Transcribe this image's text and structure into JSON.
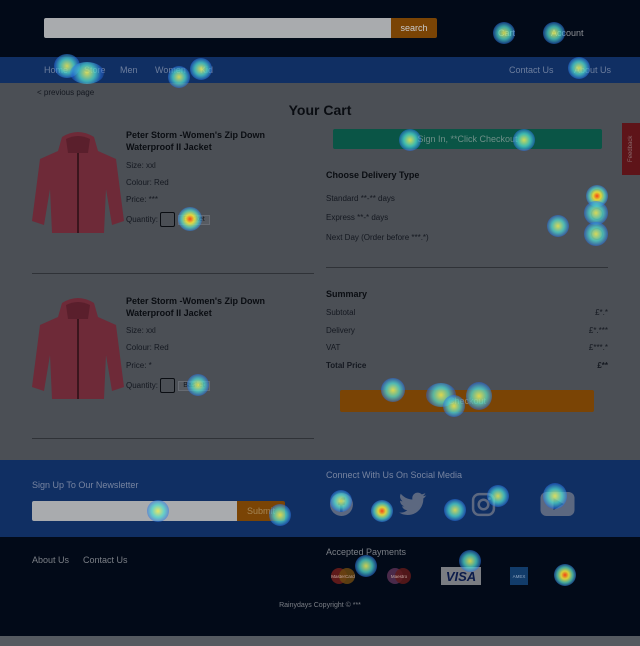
{
  "header": {
    "search_placeholder": "",
    "search_button": "search",
    "cart_link": "Cart",
    "account_link": "Account"
  },
  "nav": {
    "left": [
      "Home",
      "Store",
      "Men",
      "Women",
      "Kid"
    ],
    "right": [
      "Contact Us",
      "About Us"
    ]
  },
  "page": {
    "previous_page": "< previous page",
    "title": "Your Cart",
    "feedback_tab": "Feedback"
  },
  "products": [
    {
      "name": "Peter Storm -Women's Zip Down Waterproof II Jacket",
      "size": "Size: xxl",
      "colour": "Colour: Red",
      "price": "Price: ***",
      "quantity_label": "Quantity:",
      "basket_button": "Basket"
    },
    {
      "name": "Peter Storm -Women's Zip Down Waterproof II Jacket",
      "size": "Size: xxl",
      "colour": "Colour: Red",
      "price": "Price: *",
      "quantity_label": "Quantity:",
      "basket_button": "Basket"
    }
  ],
  "checkout": {
    "signin_button": "Sign In, **Click Checkout",
    "delivery_heading": "Choose Delivery Type",
    "delivery_options": [
      "Standard **-** days",
      "Express **-* days",
      "Next Day (Order before ***.*)"
    ],
    "summary_heading": "Summary",
    "summary_rows": [
      {
        "label": "Subtotal",
        "value": "£*.*"
      },
      {
        "label": "Delivery",
        "value": "£*.***"
      },
      {
        "label": "VAT",
        "value": "£***.*"
      },
      {
        "label": "Total Price",
        "value": "£**"
      }
    ],
    "checkout_button": "Checkout"
  },
  "newsletter": {
    "heading": "Sign Up To Our Newsletter",
    "input_placeholder": "",
    "submit_button": "Submit",
    "social_heading": "Connect With Us On Social Media"
  },
  "footer": {
    "links": [
      "About Us",
      "Contact Us"
    ],
    "payments_heading": "Accepted Payments",
    "payment_labels": [
      "MasterCard",
      "Maestro",
      "VISA",
      "AMEX"
    ],
    "copyright": "Rainydays Copyright © ***"
  },
  "colors": {
    "top_bar": "#020a18",
    "nav_bar": "#102f63",
    "accent_orange": "#7a4405",
    "accent_teal": "#0a5546",
    "heatmap_overlay": "dimmed"
  }
}
